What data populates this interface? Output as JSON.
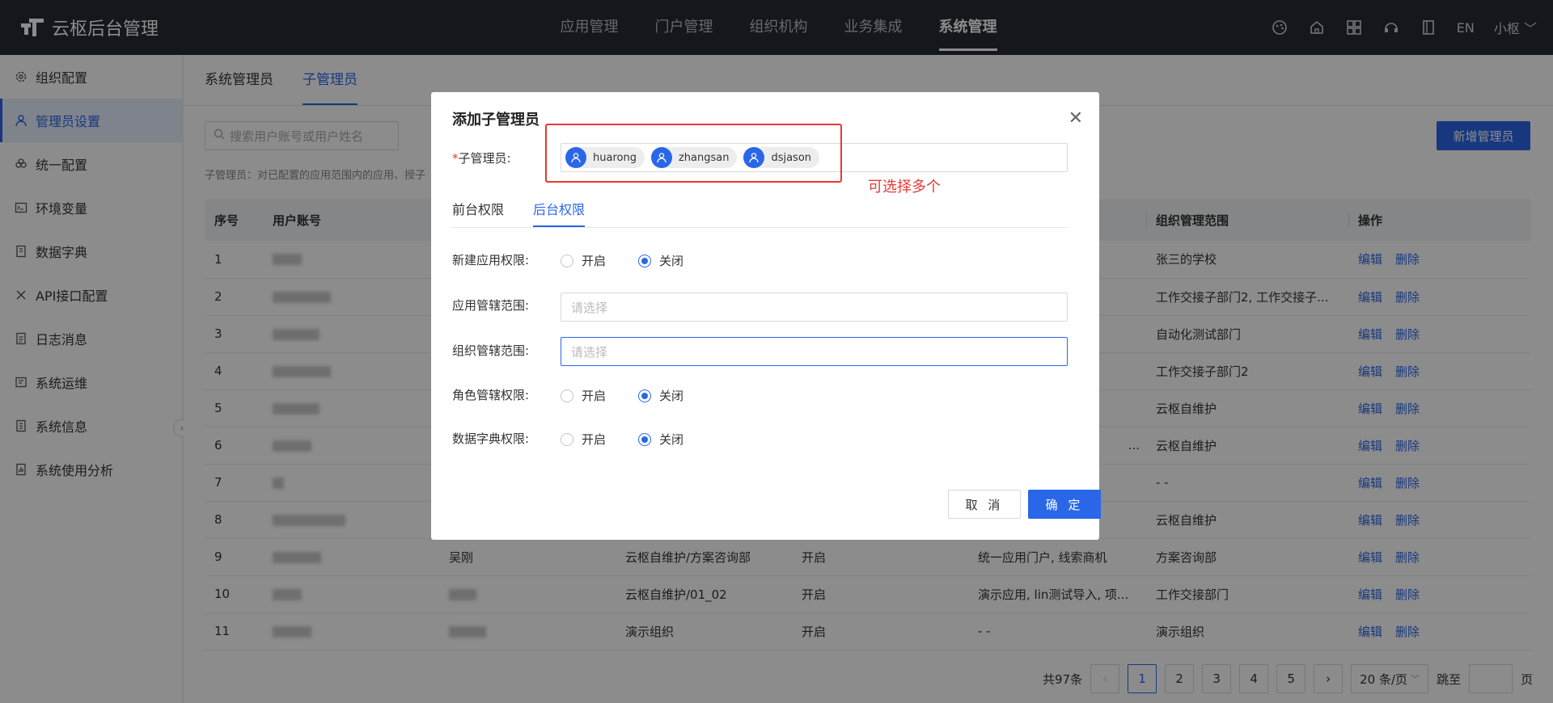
{
  "app": {
    "title": "云枢后台管理"
  },
  "topnav": {
    "items": [
      "应用管理",
      "门户管理",
      "组织机构",
      "业务集成",
      "系统管理"
    ],
    "active_index": 4
  },
  "top_icons": [
    "palette-icon",
    "home-icon",
    "grid-icon",
    "headset-icon",
    "book-icon"
  ],
  "lang": "EN",
  "user": {
    "name": "小枢"
  },
  "sidebar": {
    "items": [
      {
        "label": "组织配置",
        "icon": "gear-icon"
      },
      {
        "label": "管理员设置",
        "icon": "user-icon"
      },
      {
        "label": "统一配置",
        "icon": "cloud-config-icon"
      },
      {
        "label": "环境变量",
        "icon": "terminal-icon"
      },
      {
        "label": "数据字典",
        "icon": "dictionary-icon"
      },
      {
        "label": "API接口配置",
        "icon": "tools-icon"
      },
      {
        "label": "日志消息",
        "icon": "log-icon"
      },
      {
        "label": "系统运维",
        "icon": "ops-icon"
      },
      {
        "label": "系统信息",
        "icon": "info-doc-icon"
      },
      {
        "label": "系统使用分析",
        "icon": "analysis-icon"
      }
    ],
    "active_index": 1
  },
  "main": {
    "tabs": [
      "系统管理员",
      "子管理员"
    ],
    "active_tab": 1,
    "search_placeholder": "搜索用户账号或用户姓名",
    "add_button": "新增管理员",
    "hint": "子管理员：对已配置的应用范围内的应用、授子"
  },
  "table": {
    "headers": [
      "序号",
      "用户账号",
      "",
      "",
      "",
      "",
      "组织管理范围",
      "操作"
    ],
    "rows": [
      {
        "no": "1",
        "name": "",
        "org": "",
        "status": "",
        "apps": "",
        "scope": "张三的学校"
      },
      {
        "no": "2",
        "name": "",
        "org": "",
        "status": "",
        "apps": "",
        "scope": "工作交接子部门2, 工作交接子..."
      },
      {
        "no": "3",
        "name": "",
        "org": "",
        "status": "",
        "apps": "",
        "scope": "自动化测试部门"
      },
      {
        "no": "4",
        "name": "",
        "org": "",
        "status": "",
        "apps": "",
        "scope": "工作交接子部门2"
      },
      {
        "no": "5",
        "name": "",
        "org": "",
        "status": "",
        "apps": "",
        "scope": "云枢自维护"
      },
      {
        "no": "6",
        "name": "",
        "org": "",
        "status": "",
        "apps": "...",
        "scope": "云枢自维护"
      },
      {
        "no": "7",
        "name": "",
        "org": "",
        "status": "",
        "apps": "",
        "scope": "- -"
      },
      {
        "no": "8",
        "name": "",
        "org": "",
        "status": "",
        "apps": "",
        "scope": "云枢自维护"
      },
      {
        "no": "9",
        "name": "吴刚",
        "org": "云枢自维护/方案咨询部",
        "status": "开启",
        "apps": "统一应用门户, 线索商机",
        "scope": "方案咨询部"
      },
      {
        "no": "10",
        "name": "",
        "org": "云枢自维护/01_02",
        "status": "开启",
        "apps": "演示应用, lin测试导入, 项...",
        "scope": "工作交接部门"
      },
      {
        "no": "11",
        "name": "",
        "org": "演示组织",
        "status": "开启",
        "apps": "- -",
        "scope": "演示组织"
      }
    ],
    "op_edit": "编辑",
    "op_delete": "删除"
  },
  "pager": {
    "total": "共97条",
    "pages": [
      "1",
      "2",
      "3",
      "4",
      "5"
    ],
    "current": "1",
    "size": "20 条/页",
    "jump_label": "跳至",
    "page_suffix": "页"
  },
  "modal": {
    "title": "添加子管理员",
    "sub_admin_label": "子管理员:",
    "chips": [
      "huarong",
      "zhangsan",
      "dsjason"
    ],
    "note": "可选择多个",
    "tabs": [
      "前台权限",
      "后台权限"
    ],
    "active_tab": 1,
    "fields": {
      "new_app_perm": "新建应用权限:",
      "app_scope": "应用管辖范围:",
      "org_scope": "组织管辖范围:",
      "role_perm": "角色管辖权限:",
      "dict_perm": "数据字典权限:"
    },
    "on_label": "开启",
    "off_label": "关闭",
    "select_placeholder": "请选择",
    "cancel": "取 消",
    "ok": "确 定"
  }
}
